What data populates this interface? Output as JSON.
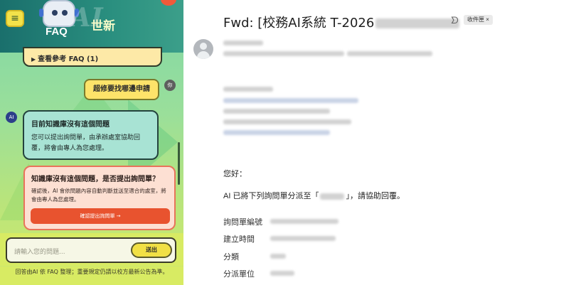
{
  "chat": {
    "menu_icon": "hamburger-menu-icon",
    "brand_ai": "AI",
    "brand_faq": "FAQ",
    "brand_sub": "世新",
    "ref_faq_label": "查看參考 FAQ (1)",
    "user_message": "超修要找哪邊申請",
    "user_avatar_text": "你",
    "ai_avatar_text": "AI",
    "ai_reply": {
      "title": "目前知識庫沒有這個問題",
      "body": "您可以提出詢問單，由承辦處室協助回覆，將會由專人為您處理。"
    },
    "confirm": {
      "title": "知識庫沒有這個問題，是否提出詢問單？",
      "body": "確認後，AI 會依問題內容自動判斷並送至適合的處室，將會由專人為您處理。",
      "button": "確認提出詢問單 →"
    },
    "input_placeholder": "請輸入您的問題...",
    "send_label": "送出",
    "disclaimer": "回答由AI 依 FAQ 整理；重要規定仍請以校方最新公告為準。",
    "colors": {
      "header": "#1a6f6c",
      "accent_yellow": "#f3e24a",
      "confirm_red": "#e8532f"
    }
  },
  "mail": {
    "subject_prefix": "Fwd: [校務AI系統 T-2026",
    "subject_tail_icon": "important-marker-icon",
    "inbox_badge": "收件匣 ×",
    "greeting": "您好：",
    "assign_prefix": "AI 已將下列詢問單分派至「",
    "assign_suffix": "」，請協助回覆。",
    "fields": [
      {
        "label": "詢問單編號"
      },
      {
        "label": "建立時間"
      },
      {
        "label": "分類"
      },
      {
        "label": "分派單位"
      }
    ]
  }
}
